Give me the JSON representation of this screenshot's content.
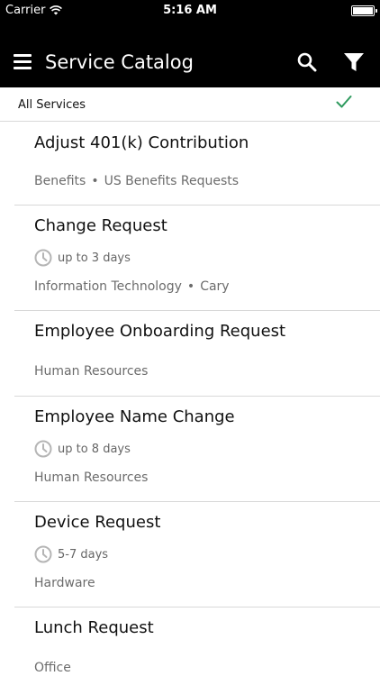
{
  "status": {
    "carrier": "Carrier",
    "time": "5:16 AM"
  },
  "nav": {
    "title": "Service Catalog"
  },
  "filter": {
    "label": "All Services",
    "accent": "#2e9a5e"
  },
  "items": [
    {
      "title": "Adjust 401(k) Contribution",
      "time": "",
      "category": "Benefits",
      "subcategory": "US Benefits Requests"
    },
    {
      "title": "Change Request",
      "time": "up to 3 days",
      "category": "Information Technology",
      "subcategory": "Cary"
    },
    {
      "title": "Employee Onboarding Request",
      "time": "",
      "category": "Human Resources",
      "subcategory": ""
    },
    {
      "title": "Employee Name Change",
      "time": "up to 8 days",
      "category": "Human Resources",
      "subcategory": ""
    },
    {
      "title": "Device Request",
      "time": "5-7 days",
      "category": "Hardware",
      "subcategory": ""
    },
    {
      "title": "Lunch Request",
      "time": "",
      "category": "Office",
      "subcategory": ""
    }
  ]
}
